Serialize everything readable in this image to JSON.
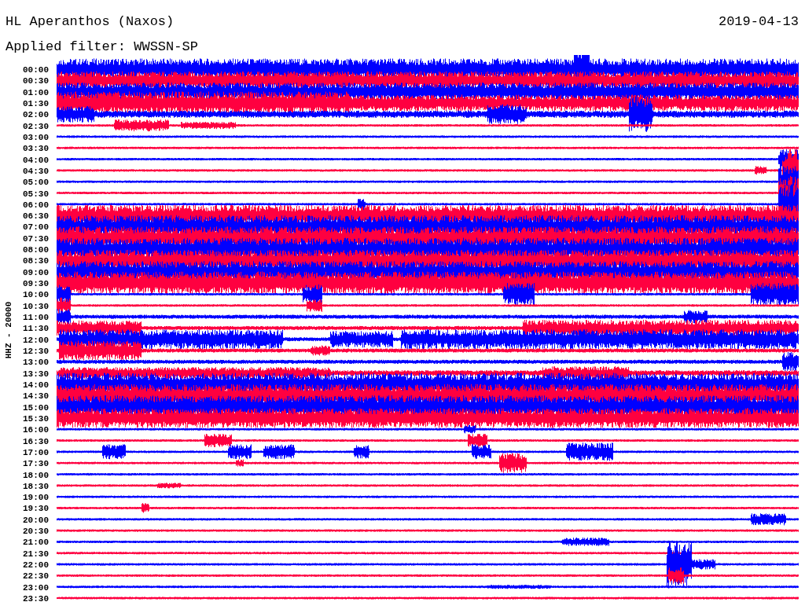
{
  "header": {
    "title": "HL Aperanthos (Naxos)",
    "date": "2019-04-13",
    "filter": "Applied filter: WWSSN-SP"
  },
  "plot": {
    "axis_label": "HHZ - 20000",
    "rows": [
      {
        "time": "00:00",
        "color": "#0000ff"
      },
      {
        "time": "00:30",
        "color": "#ff0040"
      },
      {
        "time": "01:00",
        "color": "#0000ff"
      },
      {
        "time": "01:30",
        "color": "#ff0040"
      },
      {
        "time": "02:00",
        "color": "#0000ff"
      },
      {
        "time": "02:30",
        "color": "#ff0040"
      },
      {
        "time": "03:00",
        "color": "#0000ff"
      },
      {
        "time": "03:30",
        "color": "#ff0040"
      },
      {
        "time": "04:00",
        "color": "#0000ff"
      },
      {
        "time": "04:30",
        "color": "#ff0040"
      },
      {
        "time": "05:00",
        "color": "#0000ff"
      },
      {
        "time": "05:30",
        "color": "#ff0040"
      },
      {
        "time": "06:00",
        "color": "#0000ff"
      },
      {
        "time": "06:30",
        "color": "#ff0040"
      },
      {
        "time": "07:00",
        "color": "#0000ff"
      },
      {
        "time": "07:30",
        "color": "#ff0040"
      },
      {
        "time": "08:00",
        "color": "#0000ff"
      },
      {
        "time": "08:30",
        "color": "#ff0040"
      },
      {
        "time": "09:00",
        "color": "#0000ff"
      },
      {
        "time": "09:30",
        "color": "#ff0040"
      },
      {
        "time": "10:00",
        "color": "#0000ff"
      },
      {
        "time": "10:30",
        "color": "#ff0040"
      },
      {
        "time": "11:00",
        "color": "#0000ff"
      },
      {
        "time": "11:30",
        "color": "#ff0040"
      },
      {
        "time": "12:00",
        "color": "#0000ff"
      },
      {
        "time": "12:30",
        "color": "#ff0040"
      },
      {
        "time": "13:00",
        "color": "#0000ff"
      },
      {
        "time": "13:30",
        "color": "#ff0040"
      },
      {
        "time": "14:00",
        "color": "#0000ff"
      },
      {
        "time": "14:30",
        "color": "#ff0040"
      },
      {
        "time": "15:00",
        "color": "#0000ff"
      },
      {
        "time": "15:30",
        "color": "#ff0040"
      },
      {
        "time": "16:00",
        "color": "#0000ff"
      },
      {
        "time": "16:30",
        "color": "#ff0040"
      },
      {
        "time": "17:00",
        "color": "#0000ff"
      },
      {
        "time": "17:30",
        "color": "#ff0040"
      },
      {
        "time": "18:00",
        "color": "#0000ff"
      },
      {
        "time": "18:30",
        "color": "#ff0040"
      },
      {
        "time": "19:00",
        "color": "#0000ff"
      },
      {
        "time": "19:30",
        "color": "#ff0040"
      },
      {
        "time": "20:00",
        "color": "#0000ff"
      },
      {
        "time": "20:30",
        "color": "#ff0040"
      },
      {
        "time": "21:00",
        "color": "#0000ff"
      },
      {
        "time": "21:30",
        "color": "#ff0040"
      },
      {
        "time": "22:00",
        "color": "#0000ff"
      },
      {
        "time": "22:30",
        "color": "#ff0040"
      },
      {
        "time": "23:00",
        "color": "#0000ff"
      },
      {
        "time": "23:30",
        "color": "#ff0040"
      }
    ]
  }
}
